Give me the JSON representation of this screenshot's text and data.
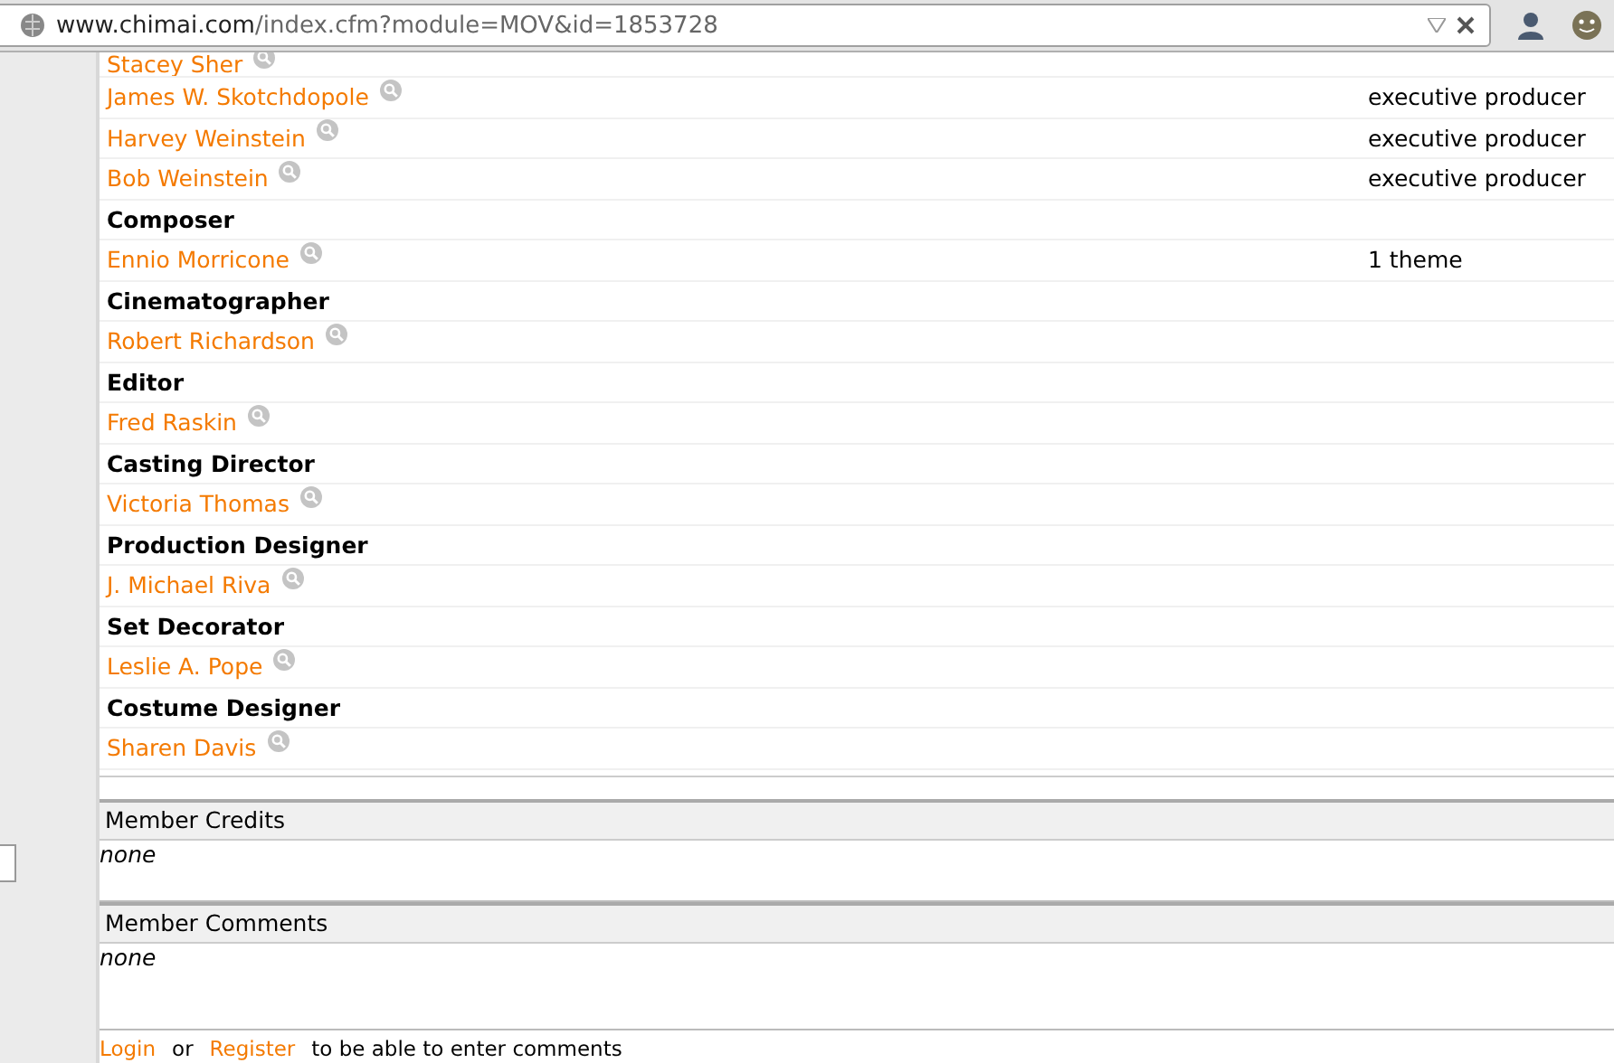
{
  "address_bar": {
    "url_domain": "www.chimai.com",
    "url_path": "/index.cfm?module=MOV&id=1853728"
  },
  "credits": [
    {
      "kind": "person",
      "name": "Stacey Sher"
    },
    {
      "kind": "person",
      "name": "James W. Skotchdopole",
      "role": "executive producer"
    },
    {
      "kind": "person",
      "name": "Harvey Weinstein",
      "role": "executive producer"
    },
    {
      "kind": "person",
      "name": "Bob Weinstein",
      "role": "executive producer"
    },
    {
      "kind": "heading",
      "name": "Composer"
    },
    {
      "kind": "person",
      "name": "Ennio Morricone",
      "role": "1 theme"
    },
    {
      "kind": "heading",
      "name": "Cinematographer"
    },
    {
      "kind": "person",
      "name": "Robert Richardson"
    },
    {
      "kind": "heading",
      "name": "Editor"
    },
    {
      "kind": "person",
      "name": "Fred Raskin"
    },
    {
      "kind": "heading",
      "name": "Casting Director"
    },
    {
      "kind": "person",
      "name": "Victoria Thomas"
    },
    {
      "kind": "heading",
      "name": "Production Designer"
    },
    {
      "kind": "person",
      "name": "J. Michael Riva"
    },
    {
      "kind": "heading",
      "name": "Set Decorator"
    },
    {
      "kind": "person",
      "name": "Leslie A. Pope"
    },
    {
      "kind": "heading",
      "name": "Costume Designer"
    },
    {
      "kind": "person",
      "name": "Sharen Davis"
    }
  ],
  "sections": [
    {
      "title": "Member Credits",
      "body": "none"
    },
    {
      "title": "Member Comments",
      "body": "none"
    }
  ],
  "footer": {
    "login": "Login",
    "or": "or",
    "register": "Register",
    "rest": "to be able to enter comments"
  }
}
